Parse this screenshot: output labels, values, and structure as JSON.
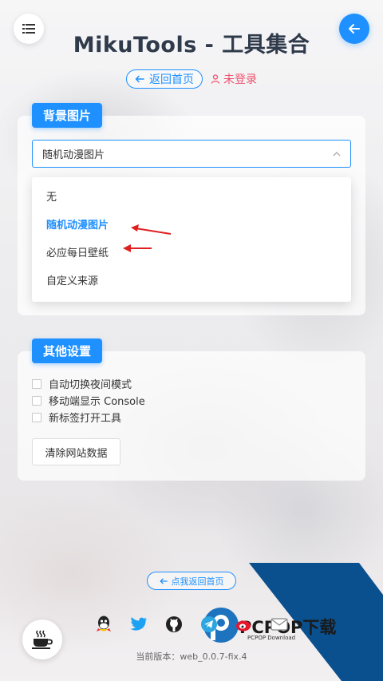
{
  "app": {
    "title": "MikuTools - 工具集合",
    "back_home_label": "返回首页",
    "login_label": "未登录"
  },
  "background_section": {
    "tag": "背景图片",
    "selected": "随机动漫图片",
    "options": [
      "无",
      "随机动漫图片",
      "必应每日壁纸",
      "自定义来源"
    ],
    "active_option_index": 1
  },
  "other_section": {
    "tag": "其他设置",
    "checkboxes": [
      {
        "label": "自动切换夜间模式",
        "checked": false
      },
      {
        "label": "移动端显示 Console",
        "checked": false
      },
      {
        "label": "新标签打开工具",
        "checked": false
      }
    ],
    "clear_button": "清除网站数据"
  },
  "footer": {
    "back_home_label": "点我返回首页",
    "social_icons": [
      "qq-icon",
      "twitter-icon",
      "github-icon",
      "telegram-icon",
      "weibo-icon",
      "mail-icon"
    ],
    "version": "当前版本：web_0.0.7-fix.4"
  },
  "watermark": {
    "text": "PCPOP下载",
    "sub": "PCPOP Download"
  },
  "colors": {
    "accent": "#1e90ff",
    "danger": "#f0506e",
    "annotation_arrow": "#e02020"
  }
}
